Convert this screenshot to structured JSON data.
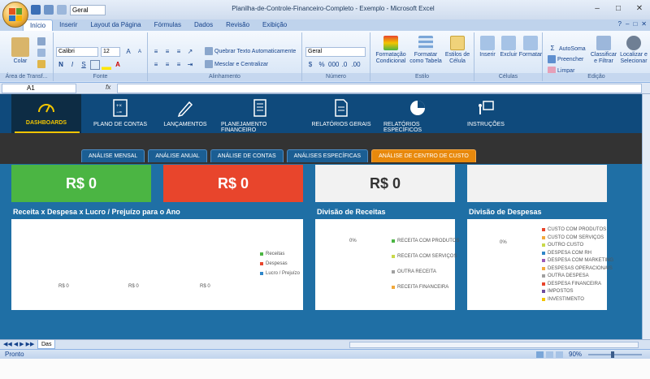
{
  "window": {
    "title": "Planilha-de-Controle-Financeiro-Completo - Exemplo - Microsoft Excel",
    "qat_font": "Geral",
    "controls": [
      "–",
      "□",
      "✕"
    ]
  },
  "ribbon": {
    "tabs": [
      "Início",
      "Inserir",
      "Layout da Página",
      "Fórmulas",
      "Dados",
      "Revisão",
      "Exibição"
    ],
    "active_tab": "Início",
    "right_controls": [
      "?",
      "–",
      "□",
      "✕"
    ],
    "clipboard": {
      "paste": "Colar",
      "label": "Área de Transf..."
    },
    "font": {
      "name": "Calibri",
      "size": "12",
      "bold": "N",
      "italic": "I",
      "underline": "S",
      "label": "Fonte"
    },
    "alignment": {
      "wrap": "Quebrar Texto Automaticamente",
      "merge": "Mesclar e Centralizar",
      "label": "Alinhamento"
    },
    "number": {
      "format": "Geral",
      "label": "Número"
    },
    "style": {
      "conditional": "Formatação Condicional",
      "as_table": "Formatar como Tabela",
      "cell_styles": "Estilos de Célula",
      "label": "Estilo"
    },
    "cells": {
      "insert": "Inserir",
      "delete": "Excluir",
      "format": "Formatar",
      "label": "Células"
    },
    "editing": {
      "autosum": "AutoSoma",
      "fill": "Preencher",
      "clear": "Limpar",
      "sort": "Classificar e Filtrar",
      "find": "Localizar e Selecionar",
      "label": "Edição"
    }
  },
  "formula_bar": {
    "name_box": "A1",
    "fx": "fx",
    "value": ""
  },
  "dashboard": {
    "nav": [
      {
        "label": "DASHBOARDS",
        "icon": "gauge-icon"
      },
      {
        "label": "PLANO DE CONTAS",
        "icon": "ledger-icon"
      },
      {
        "label": "LANÇAMENTOS",
        "icon": "pencil-icon"
      },
      {
        "label": "PLANEJAMENTO FINANCEIRO",
        "icon": "checklist-icon"
      },
      {
        "label": "RELATÓRIOS GERAIS",
        "icon": "document-icon"
      },
      {
        "label": "RELATÓRIOS ESPECÍFICOS",
        "icon": "pie-chart-icon"
      },
      {
        "label": "INSTRUÇÕES",
        "icon": "presentation-icon"
      }
    ],
    "subtabs": [
      "ANÁLISE MENSAL",
      "ANÁLISE ANUAL",
      "ANÁLISE DE CONTAS",
      "ANÁLISES ESPECÍFICAS",
      "ANÁLISE DE CENTRO DE CUSTO"
    ],
    "active_subtab": "ANÁLISE DE CENTRO DE CUSTO",
    "kpis": [
      {
        "value": "R$ 0",
        "color": "#4bb543"
      },
      {
        "value": "R$ 0",
        "color": "#e8452c"
      },
      {
        "value": "R$ 0",
        "color": "#f2f2f2"
      },
      {
        "value": "",
        "color": "#f2f2f2"
      }
    ],
    "annual": {
      "title": "Receita x Despesa x Lucro / Prejuízo para o Ano",
      "values": [
        "R$ 0",
        "R$ 0",
        "R$ 0"
      ],
      "legend": [
        {
          "label": "Receitas",
          "color": "#4bb543"
        },
        {
          "label": "Despesas",
          "color": "#e8452c"
        },
        {
          "label": "Lucro / Prejuízo",
          "color": "#2e86c9"
        }
      ]
    },
    "revenue": {
      "title": "Divisão de Receitas",
      "pct": "0%",
      "legend": [
        {
          "label": "RECEITA COM PRODUTOS",
          "color": "#4bb543"
        },
        {
          "label": "RECEITA COM SERVIÇOS",
          "color": "#c9d94a"
        },
        {
          "label": "OUTRA RECEITA",
          "color": "#a0a0a0"
        },
        {
          "label": "RECEITA FINANCEIRA",
          "color": "#f2a93b"
        }
      ]
    },
    "expenses": {
      "title": "Divisão de Despesas",
      "pct": "0%",
      "legend": [
        {
          "label": "CUSTO COM PRODUTOS",
          "color": "#e8452c"
        },
        {
          "label": "CUSTO COM SERVIÇOS",
          "color": "#f2a93b"
        },
        {
          "label": "OUTRO CUSTO",
          "color": "#c9d94a"
        },
        {
          "label": "DESPESA COM RH",
          "color": "#2e86c9"
        },
        {
          "label": "DESPESA COM MARKETING",
          "color": "#9b59b6"
        },
        {
          "label": "DESPESAS OPERACIONAIS",
          "color": "#f2a93b"
        },
        {
          "label": "OUTRA DESPESA",
          "color": "#a0a0a0"
        },
        {
          "label": "DESPESA FINANCEIRA",
          "color": "#e8452c"
        },
        {
          "label": "IMPOSTOS",
          "color": "#6d4c9c"
        },
        {
          "label": "INVESTIMENTO",
          "color": "#f2c500"
        }
      ]
    }
  },
  "sheet_tabs": {
    "active": "Das"
  },
  "status": {
    "mode": "Pronto",
    "zoom": "90%"
  }
}
